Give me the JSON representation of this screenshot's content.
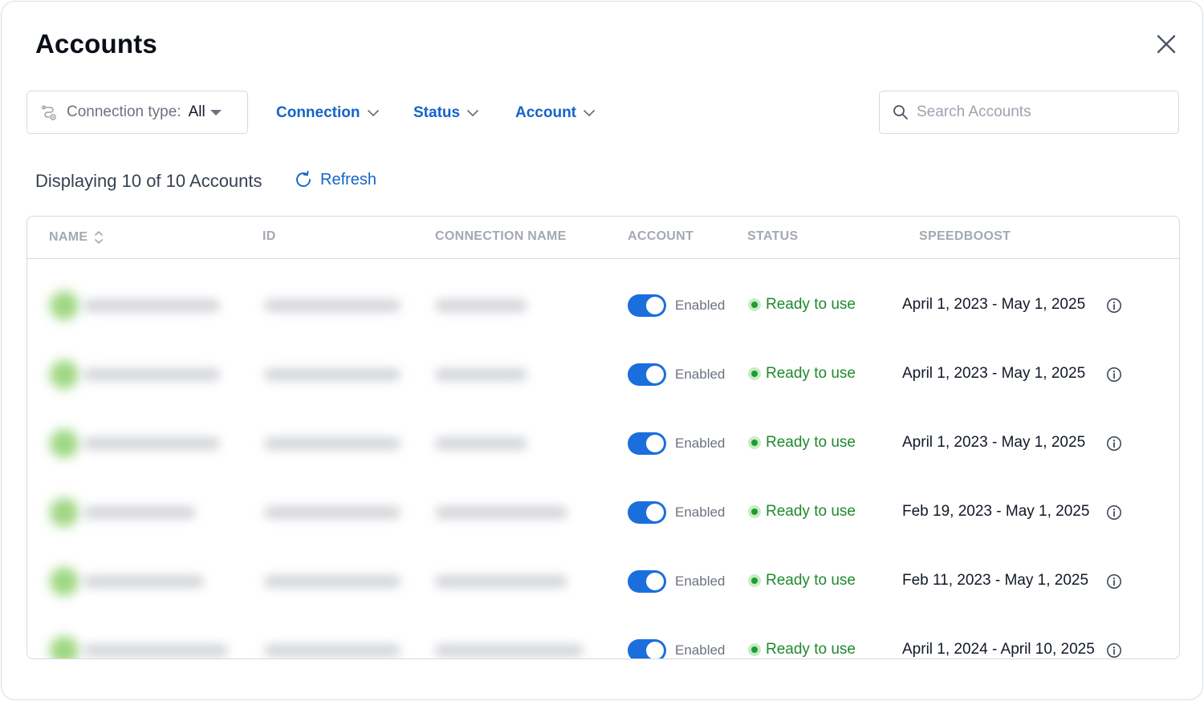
{
  "header": {
    "title": "Accounts"
  },
  "filters": {
    "connection_type_label": "Connection type:",
    "connection_type_value": "All",
    "connection_label": "Connection",
    "status_label": "Status",
    "account_label": "Account"
  },
  "search": {
    "placeholder": "Search Accounts"
  },
  "summary": {
    "count_text": "Displaying 10 of 10 Accounts",
    "refresh_label": "Refresh"
  },
  "table": {
    "columns": {
      "name": "NAME",
      "id": "ID",
      "connection_name": "CONNECTION NAME",
      "account": "ACCOUNT",
      "status": "STATUS",
      "speedboost": "SPEEDBOOST"
    },
    "rows": [
      {
        "account_state": "Enabled",
        "status": "Ready to use",
        "speedboost": "April 1, 2023 - May 1, 2025"
      },
      {
        "account_state": "Enabled",
        "status": "Ready to use",
        "speedboost": "April 1, 2023 - May 1, 2025"
      },
      {
        "account_state": "Enabled",
        "status": "Ready to use",
        "speedboost": "April 1, 2023 - May 1, 2025"
      },
      {
        "account_state": "Enabled",
        "status": "Ready to use",
        "speedboost": "Feb 19, 2023 - May 1, 2025"
      },
      {
        "account_state": "Enabled",
        "status": "Ready to use",
        "speedboost": "Feb 11, 2023 - May 1, 2025"
      },
      {
        "account_state": "Enabled",
        "status": "Ready to use",
        "speedboost": "April 1, 2024 - April 10, 2025"
      }
    ]
  },
  "colors": {
    "accent": "#1464c8",
    "toggle_on": "#1a6fdc",
    "status_ready": "#1e8a2e"
  },
  "icons": [
    "close-icon",
    "connection-type-icon",
    "chevron-down-icon",
    "search-icon",
    "refresh-icon",
    "sort-icon",
    "info-icon"
  ]
}
